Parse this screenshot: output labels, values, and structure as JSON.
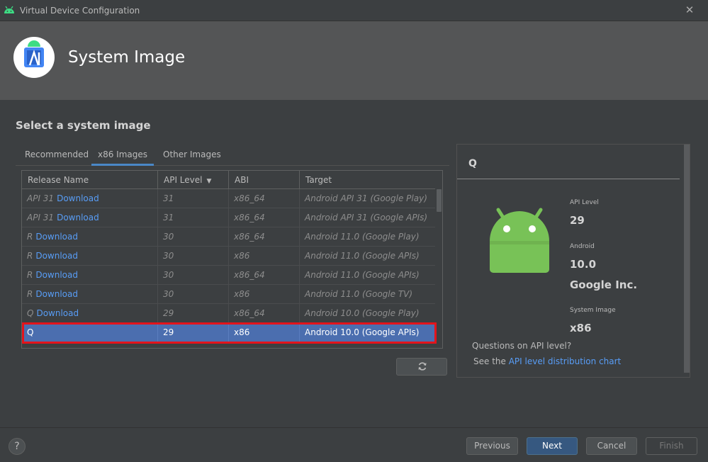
{
  "window": {
    "title": "Virtual Device Configuration"
  },
  "header": {
    "title": "System Image"
  },
  "main": {
    "section_title": "Select a system image",
    "tabs": [
      {
        "label": "Recommended"
      },
      {
        "label": "x86 Images"
      },
      {
        "label": "Other Images"
      }
    ],
    "table": {
      "columns": [
        "Release Name",
        "API Level",
        "ABI",
        "Target"
      ],
      "rows": [
        {
          "name": "API 31",
          "download": "Download",
          "api": "31",
          "abi": "x86_64",
          "target": "Android API 31 (Google Play)"
        },
        {
          "name": "API 31",
          "download": "Download",
          "api": "31",
          "abi": "x86_64",
          "target": "Android API 31 (Google APIs)"
        },
        {
          "name": "R",
          "download": "Download",
          "api": "30",
          "abi": "x86_64",
          "target": "Android 11.0 (Google Play)"
        },
        {
          "name": "R",
          "download": "Download",
          "api": "30",
          "abi": "x86",
          "target": "Android 11.0 (Google APIs)"
        },
        {
          "name": "R",
          "download": "Download",
          "api": "30",
          "abi": "x86_64",
          "target": "Android 11.0 (Google APIs)"
        },
        {
          "name": "R",
          "download": "Download",
          "api": "30",
          "abi": "x86",
          "target": "Android 11.0 (Google TV)"
        },
        {
          "name": "Q",
          "download": "Download",
          "api": "29",
          "abi": "x86_64",
          "target": "Android 10.0 (Google Play)"
        },
        {
          "name": "Q",
          "download": "",
          "api": "29",
          "abi": "x86",
          "target": "Android 10.0 (Google APIs)"
        }
      ]
    }
  },
  "details": {
    "letter": "Q",
    "api_level_label": "API Level",
    "api_level_value": "29",
    "android_label": "Android",
    "android_value": "10.0",
    "vendor": "Google Inc.",
    "system_image_label": "System Image",
    "system_image_value": "x86",
    "question": "Questions on API level?",
    "see_prefix": "See the ",
    "see_link": "API level distribution chart"
  },
  "footer": {
    "help": "?",
    "previous": "Previous",
    "next": "Next",
    "cancel": "Cancel",
    "finish": "Finish"
  },
  "colors": {
    "accent": "#4a88c7",
    "selection": "#4b6eaf",
    "highlight_outline": "#e3141b",
    "link": "#589df6",
    "android_green": "#78c257"
  }
}
